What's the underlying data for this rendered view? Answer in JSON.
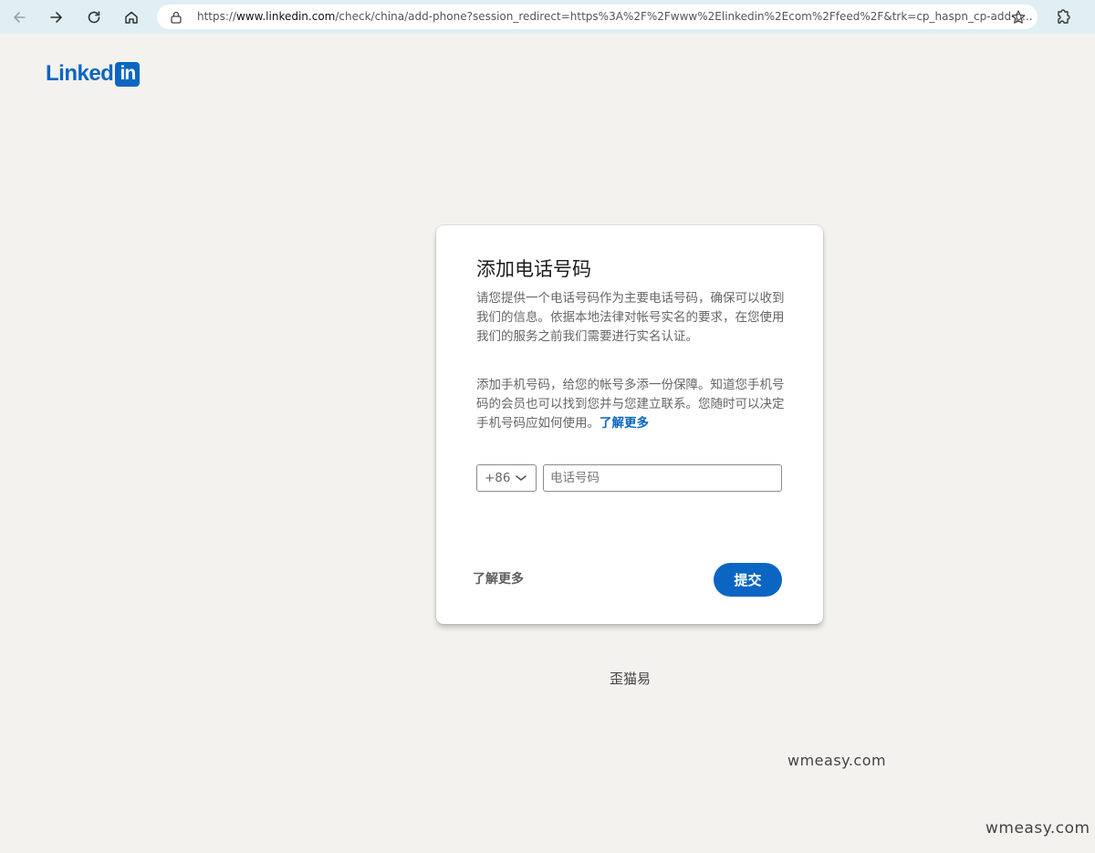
{
  "browser": {
    "url_prefix": "https://",
    "url_host": "www.linkedin.com",
    "url_path": "/check/china/add-phone?session_redirect=https%3A%2F%2Fwww%2Elinkedin%2Ecom%2Ffeed%2F&trk=cp_haspn_cp-add-p...",
    "icons": [
      "back-icon",
      "forward-icon",
      "refresh-icon",
      "home-icon",
      "lock-icon",
      "star-icon",
      "extensions-icon"
    ]
  },
  "logo": {
    "text": "Linked",
    "badge": "in"
  },
  "card": {
    "title": "添加电话号码",
    "paragraph1": "请您提供一个电话号码作为主要电话号码，确保可以收到我们的信息。依据本地法律对帐号实名的要求，在您使用我们的服务之前我们需要进行实名认证。",
    "paragraph2": "添加手机号码，给您的帐号多添一份保障。知道您手机号码的会员也可以找到您并与您建立联系。您随时可以决定手机号码应如何使用。",
    "learn_more_inline": "了解更多",
    "country_code": "+86",
    "phone_placeholder": "电话号码",
    "phone_value": "",
    "learn_more_button": "了解更多",
    "submit_button": "提交"
  },
  "footer": {
    "text": "歪猫易"
  },
  "watermarks": [
    "wmeasy.com",
    "wmeasy.com"
  ],
  "colors": {
    "brand_blue": "#0a66c2",
    "page_bg": "#f4f2ee",
    "browser_bar": "#dfeff3"
  }
}
